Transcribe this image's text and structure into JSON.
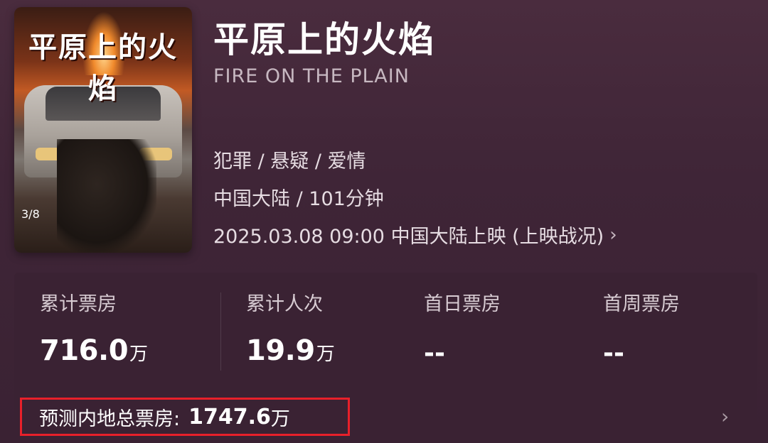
{
  "movie": {
    "title_zh": "平原上的火焰",
    "title_en": "FIRE ON THE PLAIN",
    "genres": "犯罪 / 悬疑 / 爱情",
    "region_runtime": "中国大陆 / 101分钟",
    "release": "2025.03.08 09:00 中国大陆上映 (上映战况)",
    "poster": {
      "title_art": "平原上的火焰",
      "date": "3/8"
    }
  },
  "stats": [
    {
      "label": "累计票房",
      "value": "716.0",
      "unit": "万"
    },
    {
      "label": "累计人次",
      "value": "19.9",
      "unit": "万"
    },
    {
      "label": "首日票房",
      "value": "--"
    },
    {
      "label": "首周票房",
      "value": "--"
    }
  ],
  "forecast": {
    "label": "预测内地总票房:",
    "value": "1747.6",
    "unit": "万"
  },
  "icons": {
    "release_chevron": "chevron-right-icon",
    "forecast_chevron": "chevron-right-icon"
  },
  "colors": {
    "background": "#3f2537",
    "highlight_box": "#e8202a"
  }
}
